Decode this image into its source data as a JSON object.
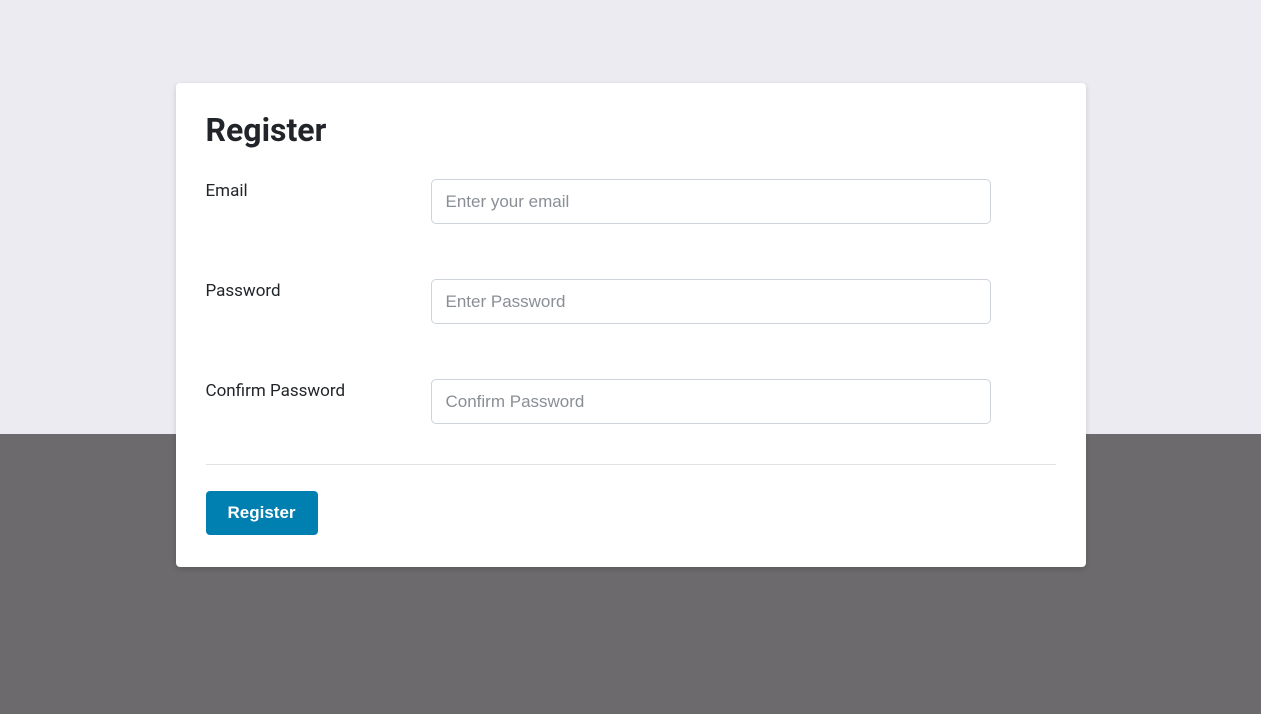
{
  "page": {
    "title": "Register"
  },
  "form": {
    "email": {
      "label": "Email",
      "placeholder": "Enter your email",
      "value": ""
    },
    "password": {
      "label": "Password",
      "placeholder": "Enter Password",
      "value": ""
    },
    "confirm_password": {
      "label": "Confirm Password",
      "placeholder": "Confirm Password",
      "value": ""
    },
    "submit_label": "Register"
  }
}
